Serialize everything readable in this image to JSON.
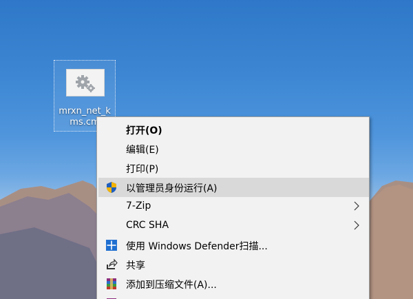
{
  "desktop_icon": {
    "label": "mrxn_net_kms.cm"
  },
  "context_menu": {
    "items": [
      {
        "label": "打开(O)"
      },
      {
        "label": "编辑(E)"
      },
      {
        "label": "打印(P)"
      },
      {
        "label": "以管理员身份运行(A)"
      },
      {
        "label": "7-Zip"
      },
      {
        "label": "CRC SHA"
      },
      {
        "label": "使用 Windows Defender扫描..."
      },
      {
        "label": "共享"
      },
      {
        "label": "添加到压缩文件(A)..."
      }
    ]
  },
  "colors": {
    "menu_background": "#f2f2f2",
    "menu_hover": "#d9d9d9",
    "menu_border": "#a0a0a0",
    "shield_blue": "#1f5fbf",
    "shield_yellow": "#f4b400"
  }
}
